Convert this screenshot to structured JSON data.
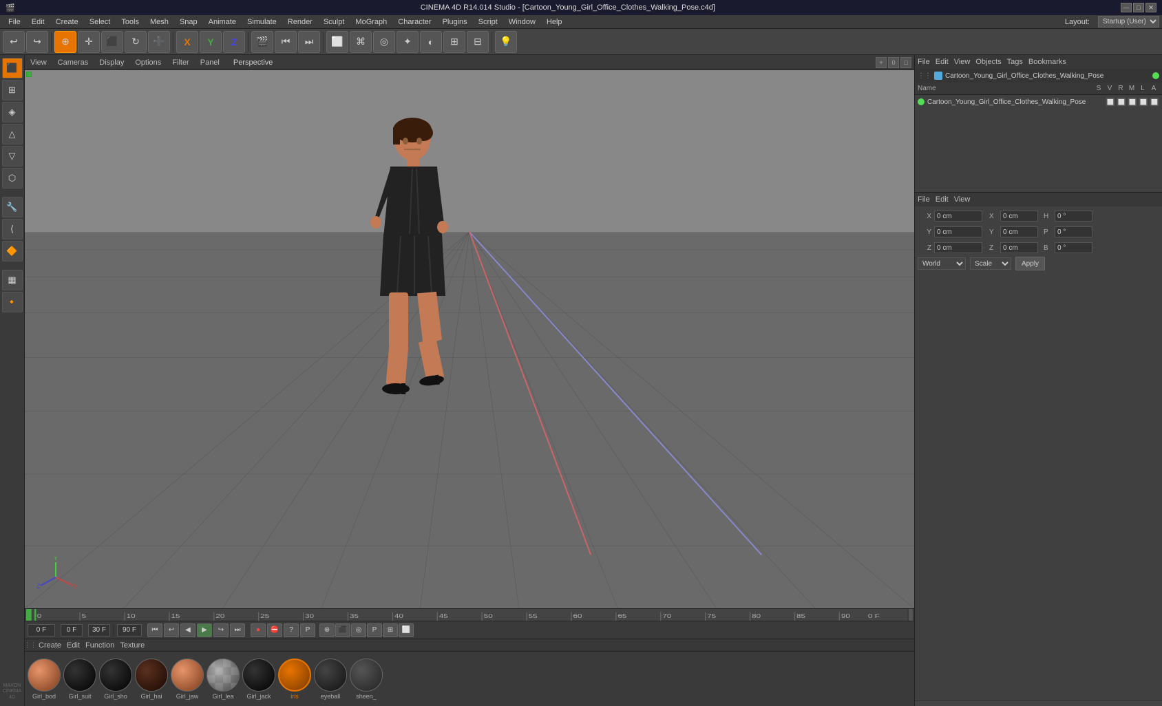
{
  "titleBar": {
    "title": "CINEMA 4D R14.014 Studio - [Cartoon_Young_Girl_Office_Clothes_Walking_Pose.c4d]",
    "winBtns": [
      "—",
      "□",
      "✕"
    ]
  },
  "menuBar": {
    "items": [
      "File",
      "Edit",
      "Create",
      "Select",
      "Tools",
      "Mesh",
      "Snap",
      "Animate",
      "Simulate",
      "Render",
      "Sculpt",
      "MoGraph",
      "Character",
      "Plugins",
      "Script",
      "Window",
      "Help"
    ],
    "rightItems": [
      "Layout:",
      "Startup (User)"
    ]
  },
  "rightPanelMenu": {
    "file": "File",
    "edit": "Edit",
    "view": "View",
    "objects": "Objects",
    "tags": "Tags",
    "bookmarks": "Bookmarks"
  },
  "objectManager": {
    "toolbar": [
      "File",
      "Edit",
      "View"
    ],
    "path": "Cartoon_Young_Girl_Office_Clothes_Walking_Pose",
    "columns": [
      "Name",
      "S",
      "V",
      "R",
      "M",
      "L",
      "A"
    ],
    "objects": [
      {
        "name": "Cartoon_Young_Girl_Office_Clothes_Walking_Pose",
        "color": "cyan",
        "icons": [
          "gray",
          "gray",
          "gray",
          "gray",
          "gray"
        ]
      }
    ]
  },
  "attrManager": {
    "toolbar": [
      "File",
      "Edit",
      "View"
    ],
    "coords": {
      "x_label": "X",
      "x_val": "0 cm",
      "h_label": "H",
      "h_val": "0 °",
      "y_label": "Y",
      "y_val": "0 cm",
      "p_label": "P",
      "p_val": "0 °",
      "z_label": "Z",
      "z_val": "0 cm",
      "b_label": "B",
      "b_val": "0 °",
      "x2_label": "X",
      "x2_val": "0 cm",
      "z2_label": "Z",
      "z2_val": "0 cm",
      "y2_label": "Y",
      "y2_val": "0 cm"
    },
    "dropdown1": "World",
    "dropdown2": "Scale",
    "applyBtn": "Apply"
  },
  "viewport": {
    "tabs": [
      "View",
      "Cameras",
      "Display",
      "Options",
      "Filter",
      "Panel"
    ],
    "perspLabel": "Perspective",
    "cornerBtns": [
      "+",
      "0",
      "□"
    ]
  },
  "timeline": {
    "marks": [
      "0",
      "5",
      "10",
      "15",
      "20",
      "25",
      "30",
      "35",
      "40",
      "45",
      "50",
      "55",
      "60",
      "65",
      "70",
      "75",
      "80",
      "85",
      "90"
    ],
    "currentFrame": "0 F",
    "totalFrames": "90 F",
    "fps": "30 F"
  },
  "transport": {
    "frameStart": "0 F",
    "frameCurrent": "0 F",
    "fps": "30 F",
    "totalEnd": "90 F",
    "buttons": [
      "⏮",
      "⏪",
      "◀",
      "▶",
      "⏩",
      "⏭",
      "●"
    ]
  },
  "materialsBar": {
    "toolbar": [
      "Create",
      "Edit",
      "Function",
      "Texture"
    ],
    "materials": [
      {
        "name": "Girl_bod",
        "color": "#c47a55",
        "type": "skin"
      },
      {
        "name": "Girl_suit",
        "color": "#111",
        "type": "dark"
      },
      {
        "name": "Girl_sho",
        "color": "#111",
        "type": "dark"
      },
      {
        "name": "Girl_hai",
        "color": "#3a1c0a",
        "type": "hair"
      },
      {
        "name": "Girl_jaw",
        "color": "#c47a55",
        "type": "skin"
      },
      {
        "name": "Girl_lea",
        "color": "#888",
        "type": "checker"
      },
      {
        "name": "Girl_jack",
        "color": "#111",
        "type": "dark"
      },
      {
        "name": "iris",
        "color": "#e87400",
        "type": "selected"
      },
      {
        "name": "eyeball",
        "color": "#222",
        "type": "dark"
      },
      {
        "name": "sheen_",
        "color": "#333",
        "type": "dark"
      }
    ]
  }
}
